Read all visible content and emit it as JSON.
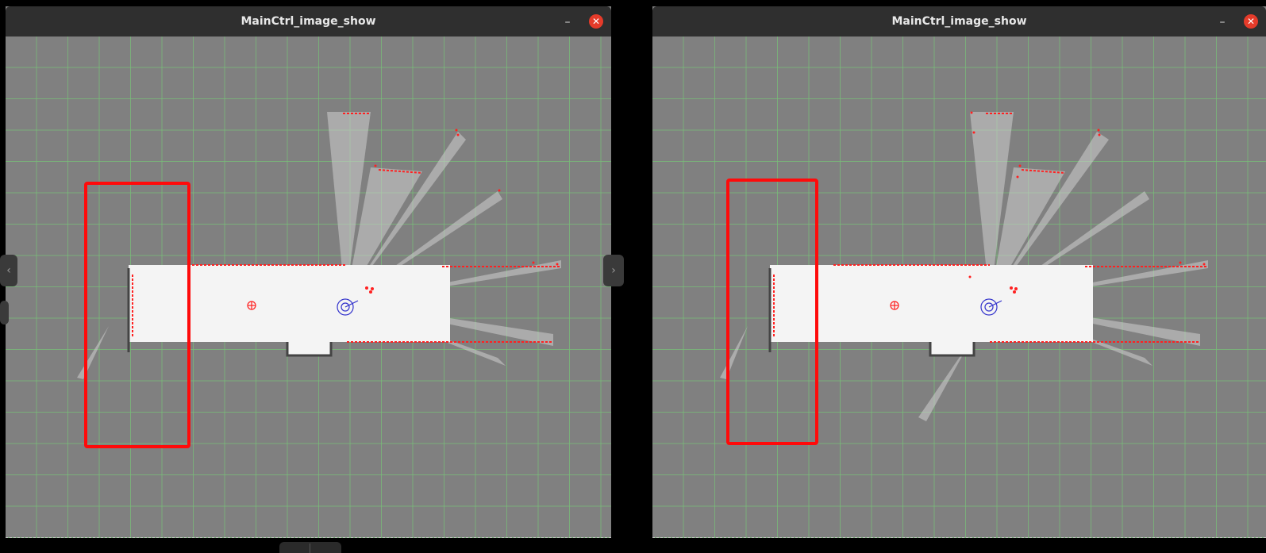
{
  "windows": [
    {
      "id": "left",
      "title": "MainCtrl_image_show",
      "minimize_label": "–",
      "close_label": "✕"
    },
    {
      "id": "right",
      "title": "MainCtrl_image_show",
      "minimize_label": "–",
      "close_label": "✕"
    }
  ],
  "nav": {
    "prev_icon": "‹",
    "next_icon": "›"
  },
  "colors": {
    "background": "#808080",
    "grid": "#78be78",
    "free_space": "#ffffff",
    "obstacle": "#ff0000",
    "highlight_box": "#ff0000",
    "robot": "#3333cc"
  }
}
